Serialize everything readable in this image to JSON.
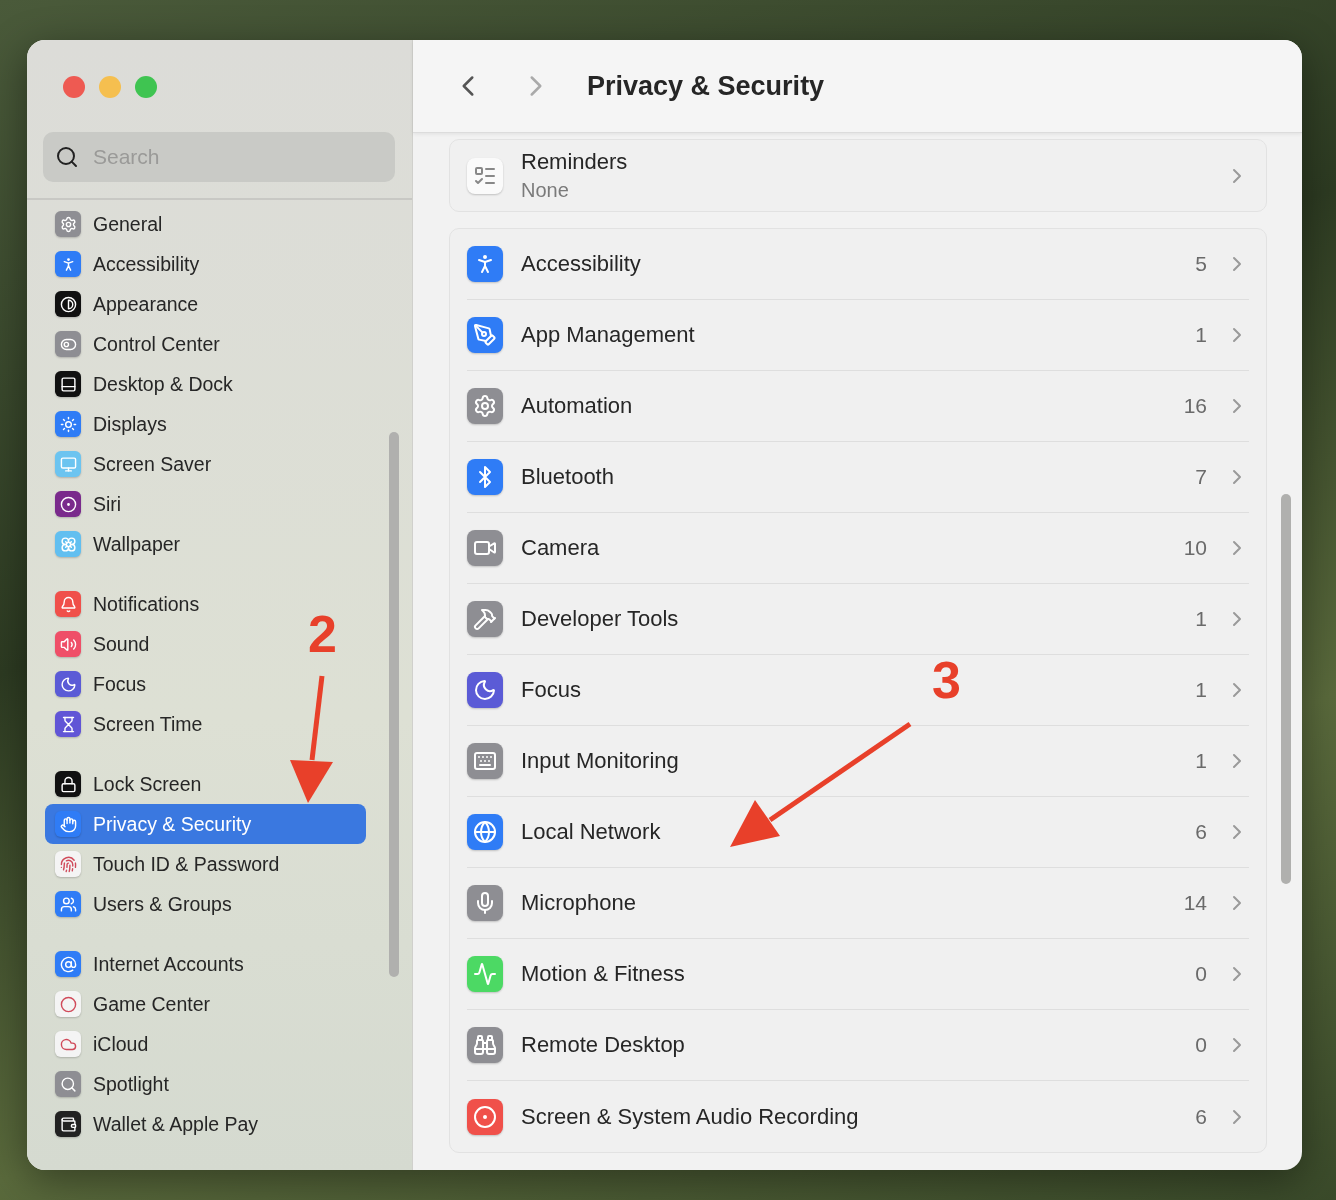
{
  "window": {
    "title": "Privacy & Security"
  },
  "search": {
    "placeholder": "Search"
  },
  "sidebar": {
    "groups": [
      [
        {
          "label": "General",
          "color": "#8e8e93",
          "selected": false
        },
        {
          "label": "Accessibility",
          "color": "#2f7cf6",
          "selected": false
        },
        {
          "label": "Appearance",
          "color": "#111111",
          "selected": false
        },
        {
          "label": "Control Center",
          "color": "#8e8e93",
          "selected": false
        },
        {
          "label": "Desktop & Dock",
          "color": "#111111",
          "selected": false
        },
        {
          "label": "Displays",
          "color": "#2f7cf6",
          "selected": false
        },
        {
          "label": "Screen Saver",
          "color": "#6cc4f0",
          "selected": false
        },
        {
          "label": "Siri",
          "color": "#7a2a8c",
          "selected": false
        },
        {
          "label": "Wallpaper",
          "color": "#62bff0",
          "selected": false
        }
      ],
      [
        {
          "label": "Notifications",
          "color": "#f0504a",
          "selected": false
        },
        {
          "label": "Sound",
          "color": "#ef4f68",
          "selected": false
        },
        {
          "label": "Focus",
          "color": "#5b5bd6",
          "selected": false
        },
        {
          "label": "Screen Time",
          "color": "#6155d6",
          "selected": false
        }
      ],
      [
        {
          "label": "Lock Screen",
          "color": "#111111",
          "selected": false
        },
        {
          "label": "Privacy & Security",
          "color": "#2f7cf6",
          "selected": true
        },
        {
          "label": "Touch ID & Password",
          "color": "#f4f4f4",
          "selected": false
        },
        {
          "label": "Users & Groups",
          "color": "#2f7cf6",
          "selected": false
        }
      ],
      [
        {
          "label": "Internet Accounts",
          "color": "#2f7cf6",
          "selected": false
        },
        {
          "label": "Game Center",
          "color": "#f4f4f4",
          "selected": false
        },
        {
          "label": "iCloud",
          "color": "#f4f4f4",
          "selected": false
        },
        {
          "label": "Spotlight",
          "color": "#8e8e93",
          "selected": false
        },
        {
          "label": "Wallet & Apple Pay",
          "color": "#222222",
          "selected": false
        }
      ]
    ]
  },
  "reminders": {
    "title": "Reminders",
    "subtitle": "None"
  },
  "rows": [
    {
      "label": "Accessibility",
      "count": "5",
      "color": "#2f7cf6"
    },
    {
      "label": "App Management",
      "count": "1",
      "color": "#2f7cf6"
    },
    {
      "label": "Automation",
      "count": "16",
      "color": "#8e8e93"
    },
    {
      "label": "Bluetooth",
      "count": "7",
      "color": "#2f7cf6"
    },
    {
      "label": "Camera",
      "count": "10",
      "color": "#8e8e93"
    },
    {
      "label": "Developer Tools",
      "count": "1",
      "color": "#8e8e93"
    },
    {
      "label": "Focus",
      "count": "1",
      "color": "#5b5bd6"
    },
    {
      "label": "Input Monitoring",
      "count": "1",
      "color": "#8e8e93"
    },
    {
      "label": "Local Network",
      "count": "6",
      "color": "#2f7cf6"
    },
    {
      "label": "Microphone",
      "count": "14",
      "color": "#8e8e93"
    },
    {
      "label": "Motion & Fitness",
      "count": "0",
      "color": "#4cd964"
    },
    {
      "label": "Remote Desktop",
      "count": "0",
      "color": "#8e8e93"
    },
    {
      "label": "Screen & System Audio Recording",
      "count": "6",
      "color": "#f0504a"
    }
  ],
  "annotations": [
    {
      "label": "2"
    },
    {
      "label": "3"
    }
  ]
}
